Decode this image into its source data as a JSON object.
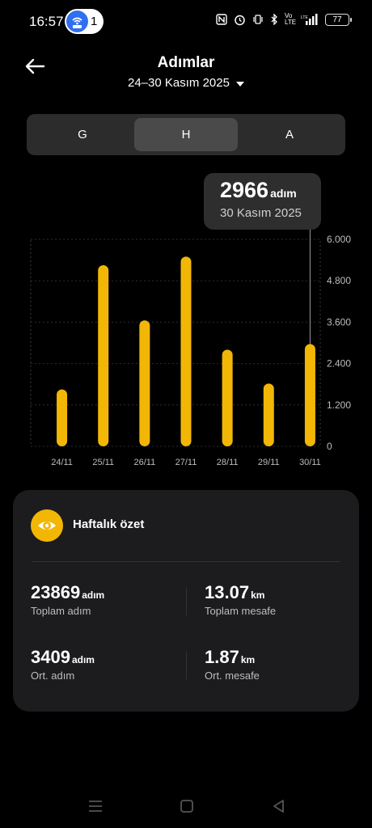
{
  "status": {
    "time": "16:57",
    "hotspot_count": "1",
    "battery": "77",
    "icons": [
      "nfc-icon",
      "alarm-icon",
      "vibrate-icon",
      "bluetooth-icon",
      "volte-icon",
      "signal-icon"
    ],
    "volte_label": "Vo LTE",
    "network_label": "LTE"
  },
  "header": {
    "title": "Adımlar",
    "date_range": "24–30 Kasım 2025"
  },
  "tabs": [
    {
      "label": "G",
      "active": false
    },
    {
      "label": "H",
      "active": true
    },
    {
      "label": "A",
      "active": false
    }
  ],
  "tooltip": {
    "value": "2966",
    "unit": "adım",
    "date": "30 Kasım 2025"
  },
  "chart_data": {
    "type": "bar",
    "categories": [
      "24/11",
      "25/11",
      "26/11",
      "27/11",
      "28/11",
      "29/11",
      "30/11"
    ],
    "values": [
      1650,
      5250,
      3650,
      5500,
      2800,
      1820,
      2966
    ],
    "ylim": [
      0,
      6000
    ],
    "yticks": [
      "0",
      "1.200",
      "2.400",
      "3.600",
      "4.800",
      "6.000"
    ],
    "ytick_values": [
      0,
      1200,
      2400,
      3600,
      4800,
      6000
    ],
    "selected_index": 6,
    "bar_color": "#f2b705",
    "grid": true
  },
  "summary": {
    "title": "Haftalık özet",
    "total_steps": {
      "value": "23869",
      "unit": "adım",
      "label": "Toplam adım"
    },
    "total_distance": {
      "value": "13.07",
      "unit": "km",
      "label": "Toplam mesafe"
    },
    "avg_steps": {
      "value": "3409",
      "unit": "adım",
      "label": "Ort. adım"
    },
    "avg_distance": {
      "value": "1.87",
      "unit": "km",
      "label": "Ort. mesafe"
    }
  },
  "colors": {
    "accent": "#f2b705",
    "background": "#000000",
    "card": "#1c1c1e"
  }
}
